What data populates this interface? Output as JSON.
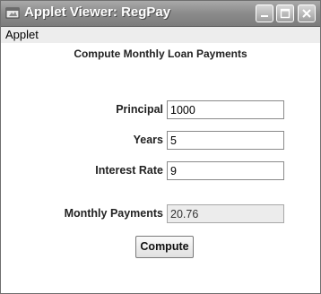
{
  "window": {
    "title": "Applet Viewer: RegPay"
  },
  "menu": {
    "items": [
      "Applet"
    ]
  },
  "form": {
    "heading": "Compute Monthly Loan Payments",
    "principal": {
      "label": "Principal",
      "value": "1000"
    },
    "years": {
      "label": "Years",
      "value": "5"
    },
    "interest": {
      "label": "Interest Rate",
      "value": "9"
    },
    "payment": {
      "label": "Monthly Payments",
      "value": "20.76"
    },
    "compute_label": "Compute"
  },
  "icons": [
    "applet-viewer-icon",
    "minimize-icon",
    "maximize-icon",
    "close-icon"
  ]
}
